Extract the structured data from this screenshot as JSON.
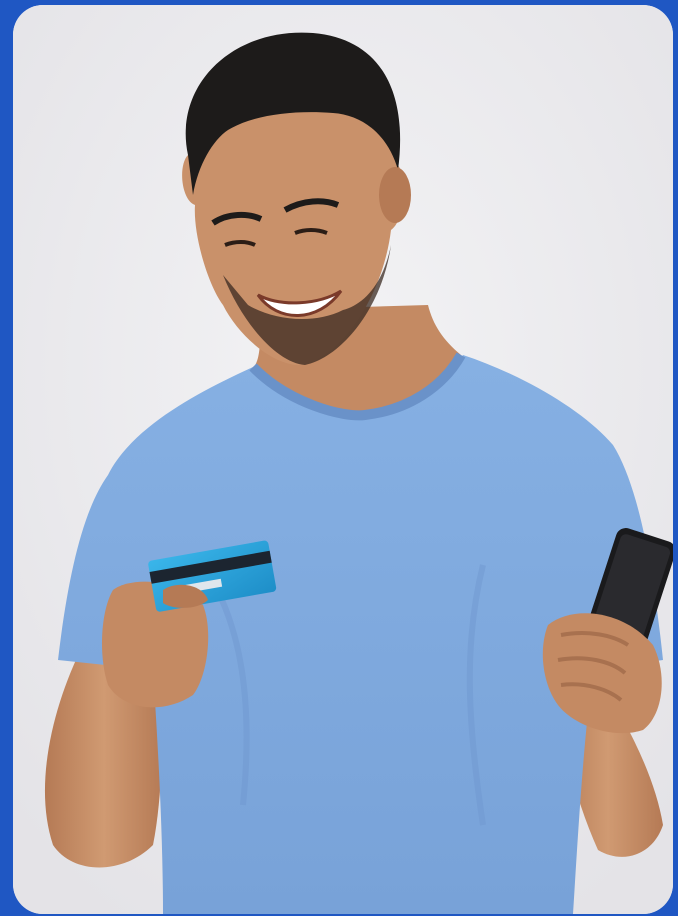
{
  "image": {
    "description_icons": [
      "person-figure",
      "credit-card-icon",
      "smartphone-icon"
    ]
  },
  "colors": {
    "frame": "#1f57c3",
    "background": "#ecebee",
    "shirt": "#7fa8dd",
    "shirt_shadow": "#6a92c9",
    "skin": "#c9916a",
    "skin_shadow": "#a8714f",
    "hair": "#1d1b1a",
    "card": "#2fa6dc",
    "card_stripe": "#1c2530",
    "phone": "#1a1a1c"
  }
}
